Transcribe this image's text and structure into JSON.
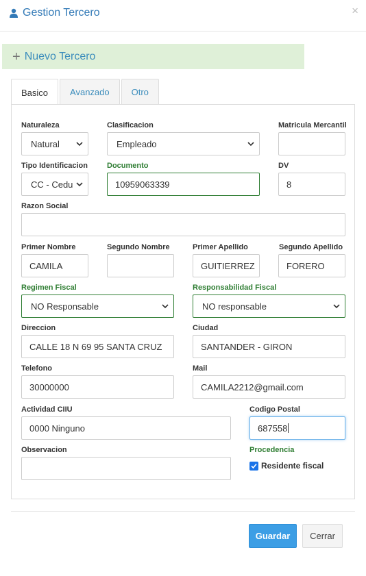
{
  "header": {
    "title": "Gestion Tercero",
    "close_label": "×"
  },
  "banner": {
    "plus": "+",
    "label": "Nuevo Tercero"
  },
  "tabs": [
    {
      "label": "Basico",
      "active": true
    },
    {
      "label": "Avanzado",
      "active": false
    },
    {
      "label": "Otro",
      "active": false
    }
  ],
  "form": {
    "naturaleza": {
      "label": "Naturaleza",
      "value": "Natural"
    },
    "clasificacion": {
      "label": "Clasificacion",
      "value": "Empleado"
    },
    "matricula": {
      "label": "Matricula Mercantil",
      "value": ""
    },
    "tipo_identificacion": {
      "label": "Tipo Identificacion",
      "value": "CC - Cedu"
    },
    "documento": {
      "label": "Documento",
      "value": "10959063339"
    },
    "dv": {
      "label": "DV",
      "value": "8"
    },
    "razon_social": {
      "label": "Razon Social",
      "value": ""
    },
    "primer_nombre": {
      "label": "Primer Nombre",
      "value": "CAMILA"
    },
    "segundo_nombre": {
      "label": "Segundo Nombre",
      "value": ""
    },
    "primer_apellido": {
      "label": "Primer Apellido",
      "value": "GUITIERREZ"
    },
    "segundo_apellido": {
      "label": "Segundo Apellido",
      "value": "FORERO"
    },
    "regimen_fiscal": {
      "label": "Regimen Fiscal",
      "value": "NO Responsable"
    },
    "responsabilidad_fiscal": {
      "label": "Responsabilidad Fiscal",
      "value": "NO responsable"
    },
    "direccion": {
      "label": "Direccion",
      "value": "CALLE 18 N 69 95 SANTA CRUZ"
    },
    "ciudad": {
      "label": "Ciudad",
      "value": "SANTANDER - GIRON"
    },
    "telefono": {
      "label": "Telefono",
      "value": "30000000"
    },
    "mail": {
      "label": "Mail",
      "value": "CAMILA2212@gmail.com"
    },
    "actividad_ciiu": {
      "label": "Actividad CIIU",
      "value": "0000 Ninguno"
    },
    "codigo_postal": {
      "label": "Codigo Postal",
      "value": "687558"
    },
    "observacion": {
      "label": "Observacion",
      "value": ""
    },
    "procedencia": {
      "label": "Procedencia",
      "checkbox_label": "Residente fiscal",
      "checked": true
    }
  },
  "footer": {
    "save_label": "Guardar",
    "close_label": "Cerrar"
  },
  "colors": {
    "accent": "#3c8dbc",
    "success": "#2e7d32",
    "banner_bg": "#dff0d8",
    "primary_button": "#3c9ee5"
  }
}
